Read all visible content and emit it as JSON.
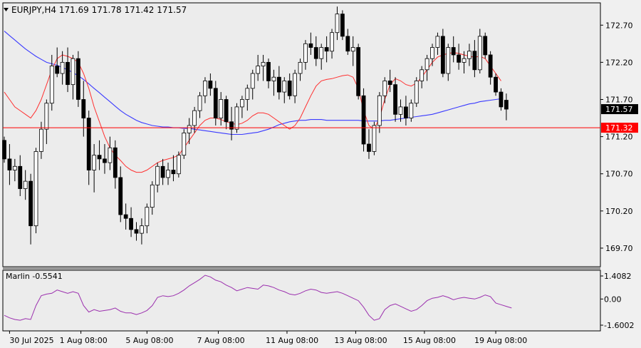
{
  "chart_data": {
    "type": "candlestick",
    "title": "EURJPY,H4",
    "ohlc_header": "171.69 171.78 171.42 171.57",
    "price_axis": {
      "ticks": [
        "172.70",
        "172.20",
        "171.70",
        "171.20",
        "170.70",
        "170.20",
        "169.70"
      ],
      "range": [
        169.45,
        173.0
      ]
    },
    "current_price": "171.57",
    "horizontal_line": {
      "price": 171.32,
      "label": "171.32",
      "color": "#ff0000"
    },
    "time_labels": [
      "30 Jul 2025",
      "1 Aug 08:00",
      "5 Aug 08:00",
      "7 Aug 08:00",
      "11 Aug 08:00",
      "13 Aug 08:00",
      "15 Aug 08:00",
      "19 Aug 08:00"
    ],
    "candles": [
      [
        171.15,
        171.2,
        170.85,
        170.9
      ],
      [
        170.9,
        171.1,
        170.55,
        170.75
      ],
      [
        170.75,
        170.9,
        170.6,
        170.8
      ],
      [
        170.8,
        170.95,
        170.4,
        170.5
      ],
      [
        170.5,
        170.75,
        170.35,
        170.6
      ],
      [
        170.6,
        170.7,
        169.75,
        170.0
      ],
      [
        170.0,
        171.05,
        169.9,
        171.0
      ],
      [
        171.0,
        171.4,
        170.9,
        171.3
      ],
      [
        171.3,
        171.7,
        171.1,
        171.65
      ],
      [
        171.65,
        172.3,
        171.55,
        172.15
      ],
      [
        172.15,
        172.4,
        172.0,
        172.05
      ],
      [
        172.05,
        172.35,
        171.9,
        172.2
      ],
      [
        172.2,
        172.4,
        171.8,
        171.9
      ],
      [
        171.9,
        172.3,
        171.7,
        172.25
      ],
      [
        172.25,
        172.35,
        171.6,
        171.7
      ],
      [
        171.7,
        171.95,
        171.2,
        171.45
      ],
      [
        171.45,
        171.55,
        170.55,
        170.75
      ],
      [
        170.75,
        171.1,
        170.45,
        170.95
      ],
      [
        170.95,
        171.15,
        170.75,
        170.9
      ],
      [
        170.9,
        171.1,
        170.7,
        170.85
      ],
      [
        170.85,
        171.2,
        170.75,
        171.05
      ],
      [
        171.05,
        171.15,
        170.5,
        170.65
      ],
      [
        170.65,
        170.8,
        170.05,
        170.15
      ],
      [
        170.15,
        170.3,
        169.95,
        170.1
      ],
      [
        170.1,
        170.25,
        169.85,
        169.95
      ],
      [
        169.95,
        170.05,
        169.8,
        169.9
      ],
      [
        169.9,
        170.1,
        169.75,
        170.0
      ],
      [
        170.0,
        170.3,
        169.9,
        170.25
      ],
      [
        170.25,
        170.6,
        170.15,
        170.55
      ],
      [
        170.55,
        170.85,
        170.45,
        170.8
      ],
      [
        170.8,
        170.9,
        170.55,
        170.65
      ],
      [
        170.65,
        170.85,
        170.55,
        170.75
      ],
      [
        170.75,
        170.95,
        170.6,
        170.7
      ],
      [
        170.7,
        171.0,
        170.65,
        170.95
      ],
      [
        170.95,
        171.3,
        170.9,
        171.25
      ],
      [
        171.25,
        171.45,
        171.1,
        171.35
      ],
      [
        171.35,
        171.6,
        171.25,
        171.55
      ],
      [
        171.55,
        171.8,
        171.45,
        171.75
      ],
      [
        171.75,
        172.0,
        171.65,
        171.95
      ],
      [
        171.95,
        172.05,
        171.75,
        171.85
      ],
      [
        171.85,
        171.95,
        171.35,
        171.45
      ],
      [
        171.45,
        171.8,
        171.35,
        171.7
      ],
      [
        171.7,
        171.75,
        171.3,
        171.4
      ],
      [
        171.4,
        171.6,
        171.15,
        171.3
      ],
      [
        171.3,
        171.65,
        171.25,
        171.6
      ],
      [
        171.6,
        171.75,
        171.45,
        171.7
      ],
      [
        171.7,
        171.9,
        171.55,
        171.85
      ],
      [
        171.85,
        172.1,
        171.7,
        172.05
      ],
      [
        172.05,
        172.3,
        171.95,
        172.15
      ],
      [
        172.15,
        172.3,
        171.95,
        172.2
      ],
      [
        172.2,
        172.25,
        171.85,
        171.95
      ],
      [
        171.95,
        172.1,
        171.75,
        172.0
      ],
      [
        172.0,
        172.15,
        171.7,
        171.8
      ],
      [
        171.8,
        172.0,
        171.65,
        171.95
      ],
      [
        171.95,
        172.05,
        171.7,
        171.75
      ],
      [
        171.75,
        172.1,
        171.65,
        172.05
      ],
      [
        172.05,
        172.25,
        171.95,
        172.2
      ],
      [
        172.2,
        172.5,
        172.1,
        172.45
      ],
      [
        172.45,
        172.6,
        172.3,
        172.4
      ],
      [
        172.4,
        172.55,
        172.15,
        172.25
      ],
      [
        172.25,
        172.45,
        172.1,
        172.4
      ],
      [
        172.4,
        172.55,
        172.2,
        172.35
      ],
      [
        172.35,
        172.65,
        172.25,
        172.6
      ],
      [
        172.6,
        172.95,
        172.5,
        172.85
      ],
      [
        172.85,
        172.9,
        172.5,
        172.55
      ],
      [
        172.55,
        172.65,
        172.3,
        172.35
      ],
      [
        172.35,
        172.55,
        172.15,
        172.4
      ],
      [
        172.4,
        172.45,
        171.7,
        171.75
      ],
      [
        171.75,
        171.85,
        171.0,
        171.1
      ],
      [
        171.1,
        171.3,
        170.9,
        171.0
      ],
      [
        171.0,
        171.4,
        170.95,
        171.35
      ],
      [
        171.35,
        171.8,
        171.25,
        171.75
      ],
      [
        171.75,
        172.0,
        171.65,
        171.95
      ],
      [
        171.95,
        172.1,
        171.8,
        171.9
      ],
      [
        171.9,
        172.0,
        171.4,
        171.5
      ],
      [
        171.5,
        171.7,
        171.4,
        171.6
      ],
      [
        171.6,
        171.75,
        171.35,
        171.45
      ],
      [
        171.45,
        171.7,
        171.4,
        171.65
      ],
      [
        171.65,
        172.0,
        171.6,
        171.95
      ],
      [
        171.95,
        172.15,
        171.85,
        172.1
      ],
      [
        172.1,
        172.3,
        171.95,
        172.25
      ],
      [
        172.25,
        172.45,
        172.15,
        172.4
      ],
      [
        172.4,
        172.6,
        172.3,
        172.55
      ],
      [
        172.55,
        172.65,
        172.0,
        172.05
      ],
      [
        172.05,
        172.45,
        171.95,
        172.4
      ],
      [
        172.4,
        172.55,
        172.2,
        172.3
      ],
      [
        172.3,
        172.45,
        172.1,
        172.2
      ],
      [
        172.2,
        172.35,
        172.05,
        172.25
      ],
      [
        172.25,
        172.45,
        172.15,
        172.35
      ],
      [
        172.35,
        172.5,
        172.0,
        172.1
      ],
      [
        172.1,
        172.65,
        172.05,
        172.55
      ],
      [
        172.55,
        172.6,
        172.25,
        172.3
      ],
      [
        172.3,
        172.35,
        171.9,
        172.0
      ],
      [
        172.0,
        172.05,
        171.75,
        171.8
      ],
      [
        171.8,
        171.85,
        171.55,
        171.6
      ],
      [
        171.69,
        171.78,
        171.42,
        171.57
      ]
    ],
    "ma_blue": [
      172.62,
      172.56,
      172.5,
      172.44,
      172.38,
      172.33,
      172.28,
      172.24,
      172.2,
      172.18,
      172.16,
      172.13,
      172.1,
      172.06,
      172.02,
      171.97,
      171.91,
      171.85,
      171.79,
      171.73,
      171.67,
      171.61,
      171.55,
      171.5,
      171.46,
      171.42,
      171.39,
      171.37,
      171.35,
      171.34,
      171.33,
      171.33,
      171.32,
      171.32,
      171.31,
      171.31,
      171.3,
      171.29,
      171.28,
      171.27,
      171.26,
      171.25,
      171.24,
      171.23,
      171.23,
      171.23,
      171.24,
      171.25,
      171.26,
      171.28,
      171.3,
      171.33,
      171.36,
      171.38,
      171.4,
      171.41,
      171.42,
      171.42,
      171.43,
      171.43,
      171.43,
      171.42,
      171.42,
      171.42,
      171.42,
      171.42,
      171.42,
      171.42,
      171.41,
      171.41,
      171.41,
      171.41,
      171.42,
      171.42,
      171.43,
      171.44,
      171.45,
      171.46,
      171.47,
      171.48,
      171.49,
      171.5,
      171.52,
      171.54,
      171.56,
      171.58,
      171.6,
      171.62,
      171.64,
      171.65,
      171.67,
      171.68,
      171.69,
      171.7,
      171.71
    ],
    "ma_red": [
      171.8,
      171.7,
      171.6,
      171.55,
      171.5,
      171.45,
      171.55,
      171.7,
      171.9,
      172.1,
      172.25,
      172.3,
      172.28,
      172.25,
      172.2,
      172.05,
      171.85,
      171.6,
      171.4,
      171.2,
      171.05,
      170.95,
      170.88,
      170.8,
      170.75,
      170.72,
      170.72,
      170.75,
      170.8,
      170.85,
      170.88,
      170.9,
      170.92,
      170.95,
      171.05,
      171.15,
      171.25,
      171.35,
      171.42,
      171.45,
      171.45,
      171.43,
      171.4,
      171.38,
      171.36,
      171.38,
      171.42,
      171.48,
      171.52,
      171.52,
      171.5,
      171.45,
      171.4,
      171.35,
      171.3,
      171.35,
      171.45,
      171.6,
      171.75,
      171.88,
      171.95,
      171.97,
      171.98,
      172.0,
      172.02,
      172.03,
      172.0,
      171.85,
      171.55,
      171.35,
      171.3,
      171.45,
      171.7,
      171.9,
      171.98,
      171.95,
      171.9,
      171.88,
      171.92,
      172.0,
      172.1,
      172.2,
      172.27,
      172.3,
      172.32,
      172.33,
      172.32,
      172.3,
      172.28,
      172.27,
      172.28,
      172.25,
      172.15,
      172.05,
      171.95
    ],
    "indicator": {
      "label": "Marlin -0.5541",
      "ticks": [
        "1.4082",
        "0.00",
        "-1.6002"
      ],
      "range": [
        -1.6002,
        1.4082
      ],
      "values": [
        -1.0,
        -1.15,
        -1.25,
        -1.3,
        -1.2,
        -1.25,
        -0.4,
        0.2,
        0.3,
        0.35,
        0.55,
        0.45,
        0.35,
        0.45,
        0.35,
        -0.4,
        -0.8,
        -0.65,
        -0.75,
        -0.7,
        -0.65,
        -0.55,
        -0.75,
        -0.85,
        -0.85,
        -0.95,
        -0.85,
        -0.7,
        -0.4,
        0.1,
        0.2,
        0.15,
        0.2,
        0.35,
        0.55,
        0.8,
        1.0,
        1.2,
        1.45,
        1.35,
        1.15,
        1.05,
        0.85,
        0.7,
        0.5,
        0.6,
        0.7,
        0.65,
        0.6,
        0.85,
        0.8,
        0.7,
        0.55,
        0.45,
        0.3,
        0.25,
        0.35,
        0.5,
        0.6,
        0.55,
        0.4,
        0.35,
        0.4,
        0.45,
        0.35,
        0.2,
        0.05,
        -0.1,
        -0.5,
        -1.0,
        -1.3,
        -1.2,
        -0.65,
        -0.4,
        -0.3,
        -0.45,
        -0.6,
        -0.75,
        -0.65,
        -0.4,
        -0.1,
        0.05,
        0.1,
        0.2,
        0.1,
        -0.05,
        0.05,
        0.1,
        0.05,
        0.0,
        0.1,
        0.25,
        0.15,
        -0.25,
        -0.35,
        -0.45,
        -0.55
      ]
    }
  }
}
